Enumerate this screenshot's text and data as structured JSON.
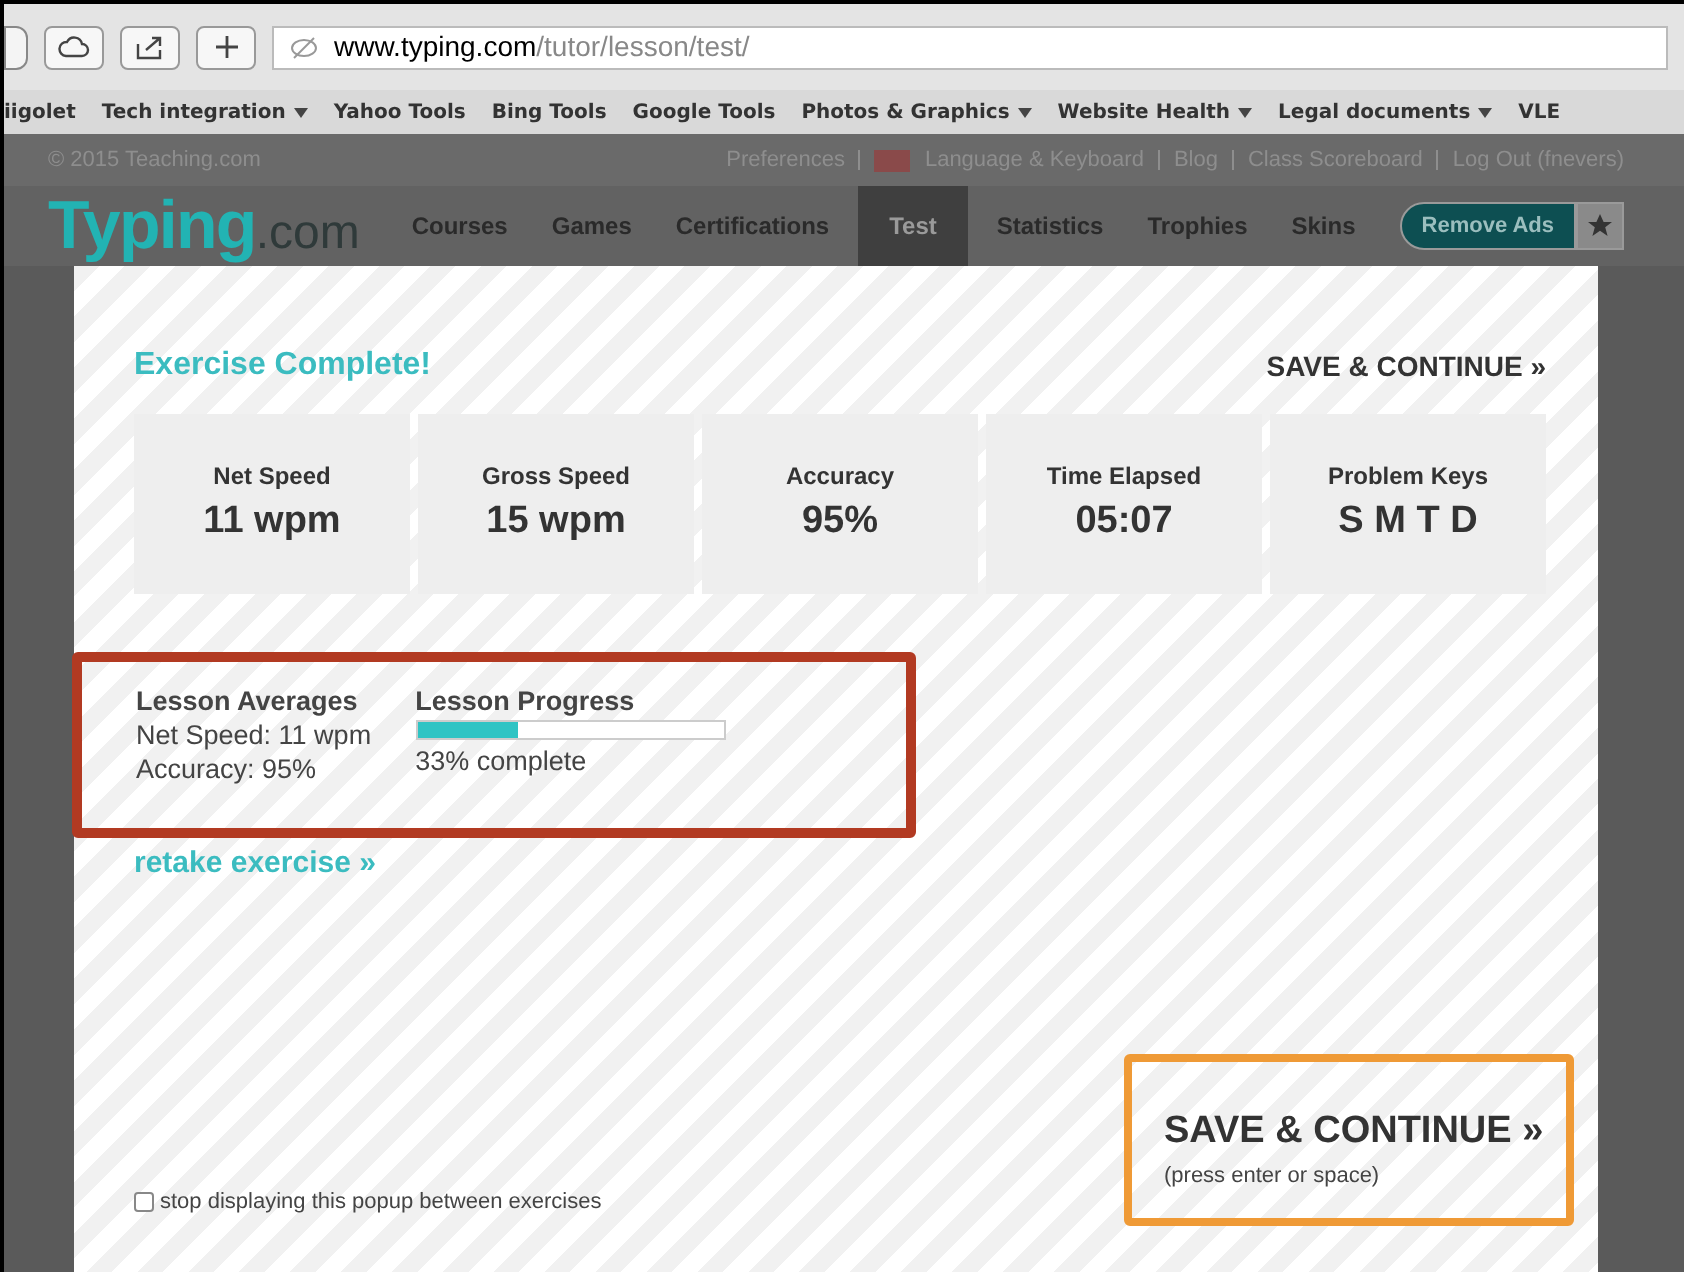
{
  "browser": {
    "url_host": "www.typing.com",
    "url_path": "/tutor/lesson/test/",
    "bookmarks": [
      {
        "label": "iigolet",
        "menu": false
      },
      {
        "label": "Tech integration",
        "menu": true
      },
      {
        "label": "Yahoo Tools",
        "menu": false
      },
      {
        "label": "Bing Tools",
        "menu": false
      },
      {
        "label": "Google Tools",
        "menu": false
      },
      {
        "label": "Photos & Graphics",
        "menu": true
      },
      {
        "label": "Website Health",
        "menu": true
      },
      {
        "label": "Legal documents",
        "menu": true
      },
      {
        "label": "VLE",
        "menu": false
      }
    ]
  },
  "site": {
    "copyright": "© 2015 Teaching.com",
    "top_links": [
      "Preferences",
      "Language & Keyboard",
      "Blog",
      "Class Scoreboard",
      "Log Out (fnevers)"
    ],
    "logo_main": "Typing",
    "logo_suffix": ".com",
    "nav": [
      {
        "label": "Courses",
        "selected": false
      },
      {
        "label": "Games",
        "selected": false
      },
      {
        "label": "Certifications",
        "selected": false
      },
      {
        "label": "Test",
        "selected": true
      },
      {
        "label": "Statistics",
        "selected": false
      },
      {
        "label": "Trophies",
        "selected": false
      },
      {
        "label": "Skins",
        "selected": false
      }
    ],
    "remove_ads": "Remove Ads"
  },
  "modal": {
    "title": "Exercise Complete!",
    "top_action": "SAVE & CONTINUE »",
    "stats": [
      {
        "label": "Net Speed",
        "value": "11 wpm"
      },
      {
        "label": "Gross Speed",
        "value": "15 wpm"
      },
      {
        "label": "Accuracy",
        "value": "95%"
      },
      {
        "label": "Time Elapsed",
        "value": "05:07"
      },
      {
        "label": "Problem Keys",
        "value": "S M T D"
      }
    ],
    "averages": {
      "title": "Lesson Averages",
      "lines": [
        "Net Speed: 11 wpm",
        "Accuracy: 95%"
      ]
    },
    "progress": {
      "title": "Lesson Progress",
      "level": 0.33,
      "caption": "33% complete"
    },
    "retake": "retake exercise »",
    "stop_popup": {
      "label": "stop displaying this popup between exercises",
      "checked": false
    },
    "save": {
      "label": "SAVE & CONTINUE »",
      "hint": "(press enter or space)"
    }
  }
}
